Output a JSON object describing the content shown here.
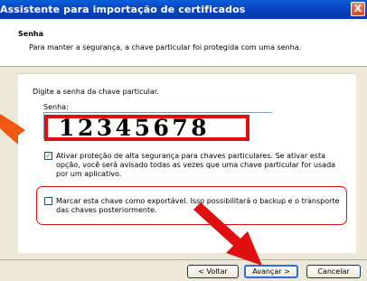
{
  "window": {
    "title": "Assistente para importação de certificados",
    "close_glyph": "X"
  },
  "header": {
    "title": "Senha",
    "description": "Para manter a segurança, a chave particular foi protegida com uma senha."
  },
  "content": {
    "prompt": "Digite a senha da chave particular.",
    "password_label": "Senha:",
    "password_value": "12345678",
    "strong_protection": {
      "checked": true,
      "check_glyph": "✓",
      "lines": [
        "Ativar proteção de alta segurança para chaves particulares. Se ativar esta",
        "opção, você será avisado todas as vezes que uma chave particular for usada",
        "por um aplicativo."
      ]
    },
    "exportable": {
      "checked": false,
      "lines": [
        "Marcar esta chave como exportável. Isso possibilitará o backup e o transporte",
        "das chaves posteriormente."
      ]
    }
  },
  "buttons": {
    "back": "< Voltar",
    "next": "Avançar >",
    "cancel": "Cancelar"
  },
  "colors": {
    "highlight": "#e01010",
    "titlebar": "#0a46c6",
    "arrow": "#f05a10"
  }
}
